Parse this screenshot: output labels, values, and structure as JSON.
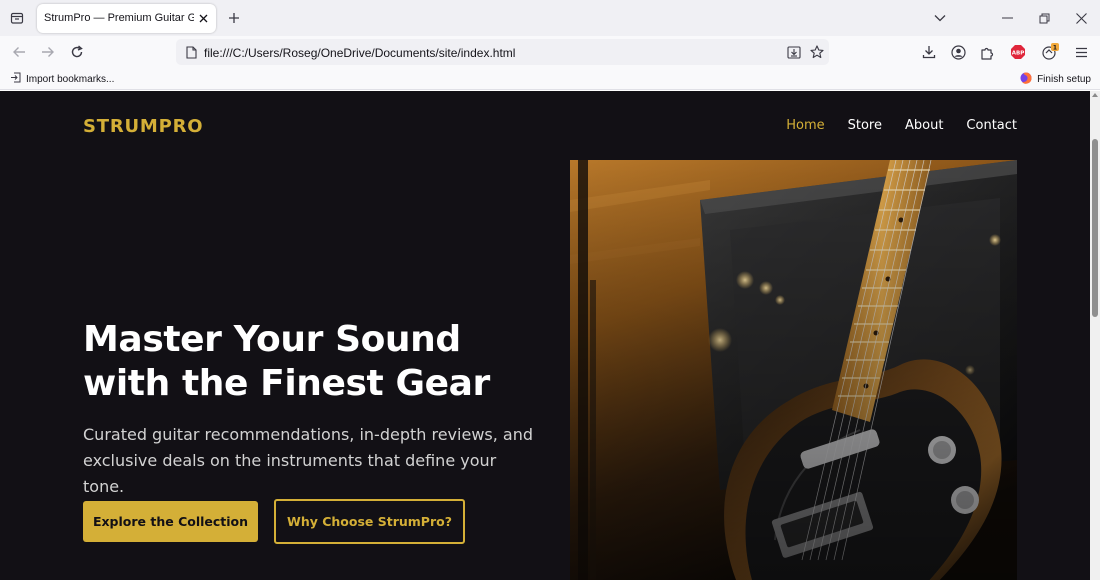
{
  "browser": {
    "tab_title": "StrumPro — Premium Guitar Gear &",
    "url": "file:///C:/Users/Roseg/OneDrive/Documents/site/index.html",
    "bookmarks": {
      "import_label": "Import bookmarks...",
      "finish_setup_label": "Finish setup"
    },
    "extension_badge": "ABP",
    "notification_badge": "1"
  },
  "site": {
    "logo": "STRUMPRO",
    "nav": [
      {
        "label": "Home",
        "active": true
      },
      {
        "label": "Store",
        "active": false
      },
      {
        "label": "About",
        "active": false
      },
      {
        "label": "Contact",
        "active": false
      }
    ]
  },
  "hero": {
    "title_line1": "Master Your Sound",
    "title_line2": "with the Finest Gear",
    "subtitle": "Curated guitar recommendations, in-depth reviews, and exclusive deals on the instruments that define your tone.",
    "primary_button": "Explore the Collection",
    "secondary_button": "Why Choose StrumPro?"
  },
  "colors": {
    "accent": "#d4af37",
    "background": "#121015",
    "text": "#ffffff"
  },
  "icons": [
    "tab-list-icon",
    "close-icon",
    "plus-icon",
    "chevron-down-icon",
    "minimize-icon",
    "restore-icon",
    "back-icon",
    "forward-icon",
    "reload-icon",
    "page-icon",
    "save-page-icon",
    "bookmark-star-icon",
    "download-icon",
    "account-icon",
    "extensions-icon",
    "adblock-icon",
    "notification-icon",
    "menu-icon",
    "import-icon",
    "firefox-icon"
  ]
}
